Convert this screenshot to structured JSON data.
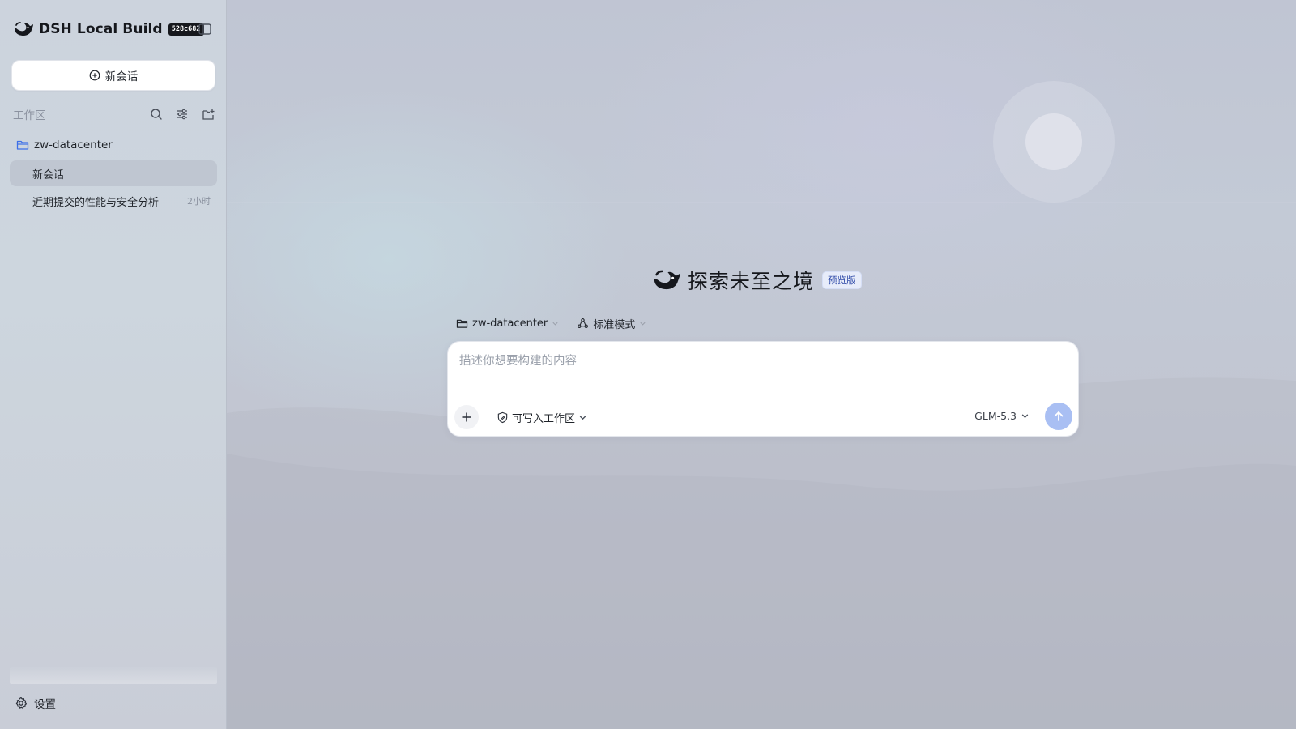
{
  "sidebar": {
    "app_name": "DSH Local Build",
    "build_badge": "528c682",
    "new_chat_label": "新会话",
    "workspace_label": "工作区",
    "folder": {
      "name": "zw-datacenter",
      "icon": "folder-icon"
    },
    "sessions": [
      {
        "title": "新会话",
        "time": "",
        "active": true
      },
      {
        "title": "近期提交的性能与安全分析",
        "time": "2小时",
        "active": false
      }
    ],
    "settings_label": "设置"
  },
  "main": {
    "hero_title": "探索未至之境",
    "preview_badge": "预览版",
    "workspace_selector": "zw-datacenter",
    "mode_selector": "标准模式",
    "composer": {
      "placeholder": "描述你想要构建的内容",
      "value": "",
      "permission_label": "可写入工作区",
      "model_label": "GLM-5.3"
    }
  },
  "colors": {
    "accent_send": "#a9bff3",
    "folder_icon": "#3d6fe8",
    "badge_bg": "#16181d",
    "preview_badge_text": "#2f4aa8"
  }
}
